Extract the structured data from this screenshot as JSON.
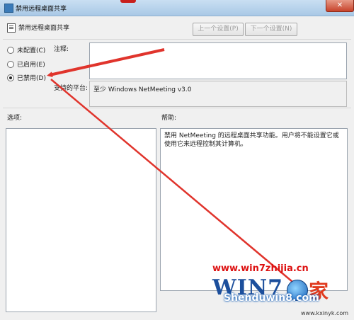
{
  "window": {
    "title": "禁用远程桌面共享",
    "close_label": "✕"
  },
  "header": {
    "policy_name": "禁用远程桌面共享",
    "prev_label": "上一个设置(P)",
    "next_label": "下一个设置(N)"
  },
  "state": {
    "options": [
      {
        "label": "未配置(C)",
        "selected": false
      },
      {
        "label": "已启用(E)",
        "selected": false
      },
      {
        "label": "已禁用(D)",
        "selected": true
      }
    ]
  },
  "fields": {
    "comment_label": "注释:",
    "comment_value": "",
    "platform_label": "支持的平台:",
    "platform_value": "至少 Windows NetMeeting v3.0"
  },
  "panes": {
    "options_label": "选项:",
    "help_label": "帮助:",
    "help_text": "禁用 NetMeeting 的远程桌面共享功能。用户将不能设置它或使用它来远程控制其计算机。"
  },
  "watermark": {
    "url": "www.win7zhijia.cn",
    "logo_text": "WIN7",
    "logo_char": "家",
    "site": "Shenduwin8.com",
    "small": "www.kxinyk.com"
  },
  "colors": {
    "annotation_arrow": "#e0342c",
    "accent": "#1c4f9c"
  }
}
